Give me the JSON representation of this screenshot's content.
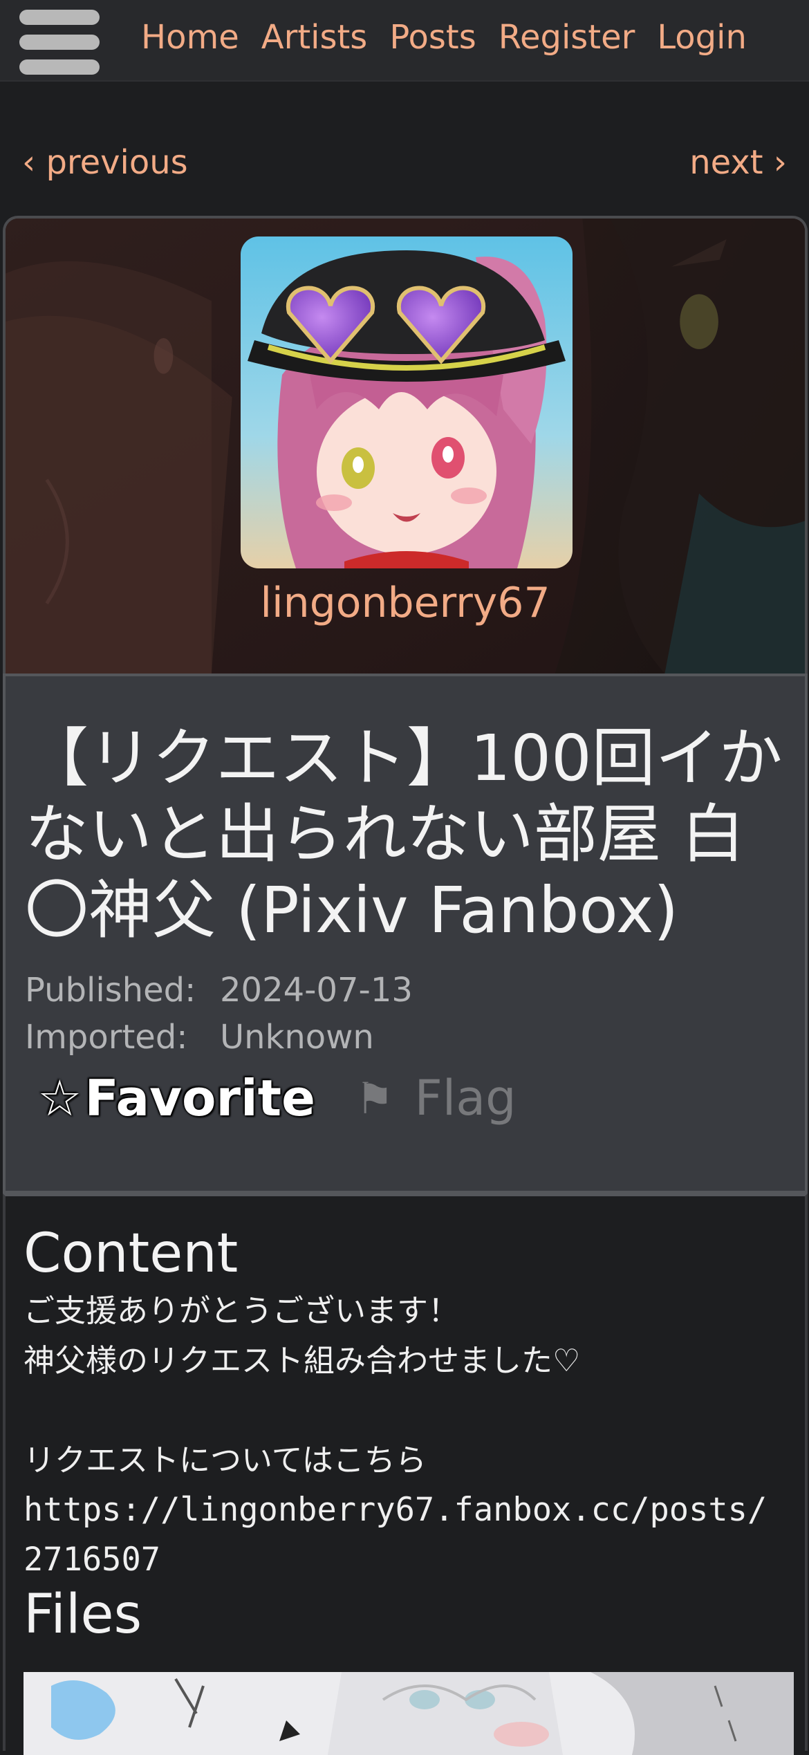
{
  "nav": {
    "menu_icon": "hamburger-menu-icon",
    "links": [
      "Home",
      "Artists",
      "Posts",
      "Register",
      "Login"
    ]
  },
  "paginator": {
    "previous": "‹ previous",
    "next": "next ›"
  },
  "artist": {
    "name": "lingonberry67"
  },
  "post": {
    "title": "【リクエスト】100回イかないと出られない部屋 白〇神父 (Pixiv Fanbox)",
    "published_label": "Published:",
    "published_value": "2024-07-13",
    "imported_label": "Imported:",
    "imported_value": "Unknown",
    "favorite_icon": "☆",
    "favorite_label": "Favorite",
    "flag_icon": "⚑",
    "flag_label": "Flag"
  },
  "content": {
    "heading": "Content",
    "lines": [
      "ご支援ありがとうございます！",
      "神父様のリクエスト組み合わせました♡",
      "",
      "リクエストについてはこちら"
    ],
    "link_line1": "https://lingonberry67.fanbox.cc/posts/",
    "link_line2": "2716507"
  },
  "files": {
    "heading": "Files"
  },
  "colors": {
    "accent": "#f2ab86",
    "background": "#1d1e20",
    "header_panel": "#393b40",
    "topbar": "#28292c"
  }
}
